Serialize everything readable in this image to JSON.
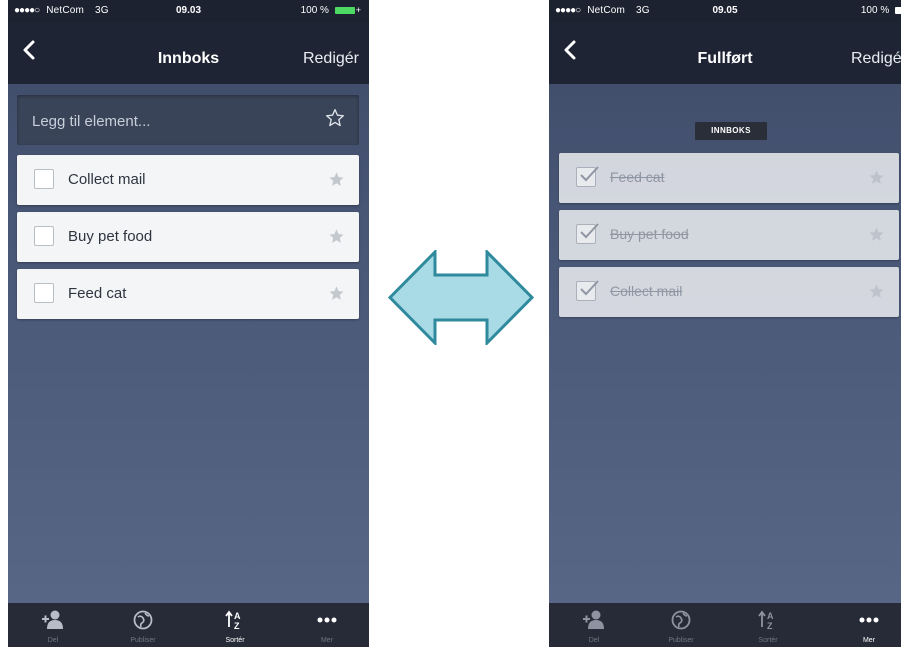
{
  "left_screen": {
    "status": {
      "carrier": "NetCom",
      "network": "3G",
      "time": "09.03",
      "battery": "100 %"
    },
    "nav": {
      "title": "Innboks",
      "edit_label": "Redigér"
    },
    "add_placeholder": "Legg til element...",
    "tasks": [
      {
        "label": "Collect mail"
      },
      {
        "label": "Buy pet food"
      },
      {
        "label": "Feed cat"
      }
    ]
  },
  "right_screen": {
    "status": {
      "carrier": "NetCom",
      "network": "3G",
      "time": "09.05",
      "battery": "100 %"
    },
    "nav": {
      "title": "Fullført",
      "edit_label": "Redigér"
    },
    "section_label": "INNBOKS",
    "completed_tasks": [
      {
        "label": "Feed cat"
      },
      {
        "label": "Buy pet food"
      },
      {
        "label": "Collect mail"
      }
    ]
  },
  "tab_bar": {
    "items": [
      {
        "label": "Del",
        "icon": "add-user-icon"
      },
      {
        "label": "Publiser",
        "icon": "globe-icon"
      },
      {
        "label": "Sortér",
        "icon": "sort-icon"
      },
      {
        "label": "Mer",
        "icon": "more-icon"
      }
    ],
    "left_active": "Sortér",
    "right_active": "Mer"
  },
  "colors": {
    "background_top": "#3d4a66",
    "nav_bar": "#1e2433",
    "tab_bar": "#262b37",
    "task_bg": "#f4f5f7",
    "arrow_fill": "#a8dbe6",
    "arrow_stroke": "#2e8a9c",
    "battery": "#4cd964"
  }
}
